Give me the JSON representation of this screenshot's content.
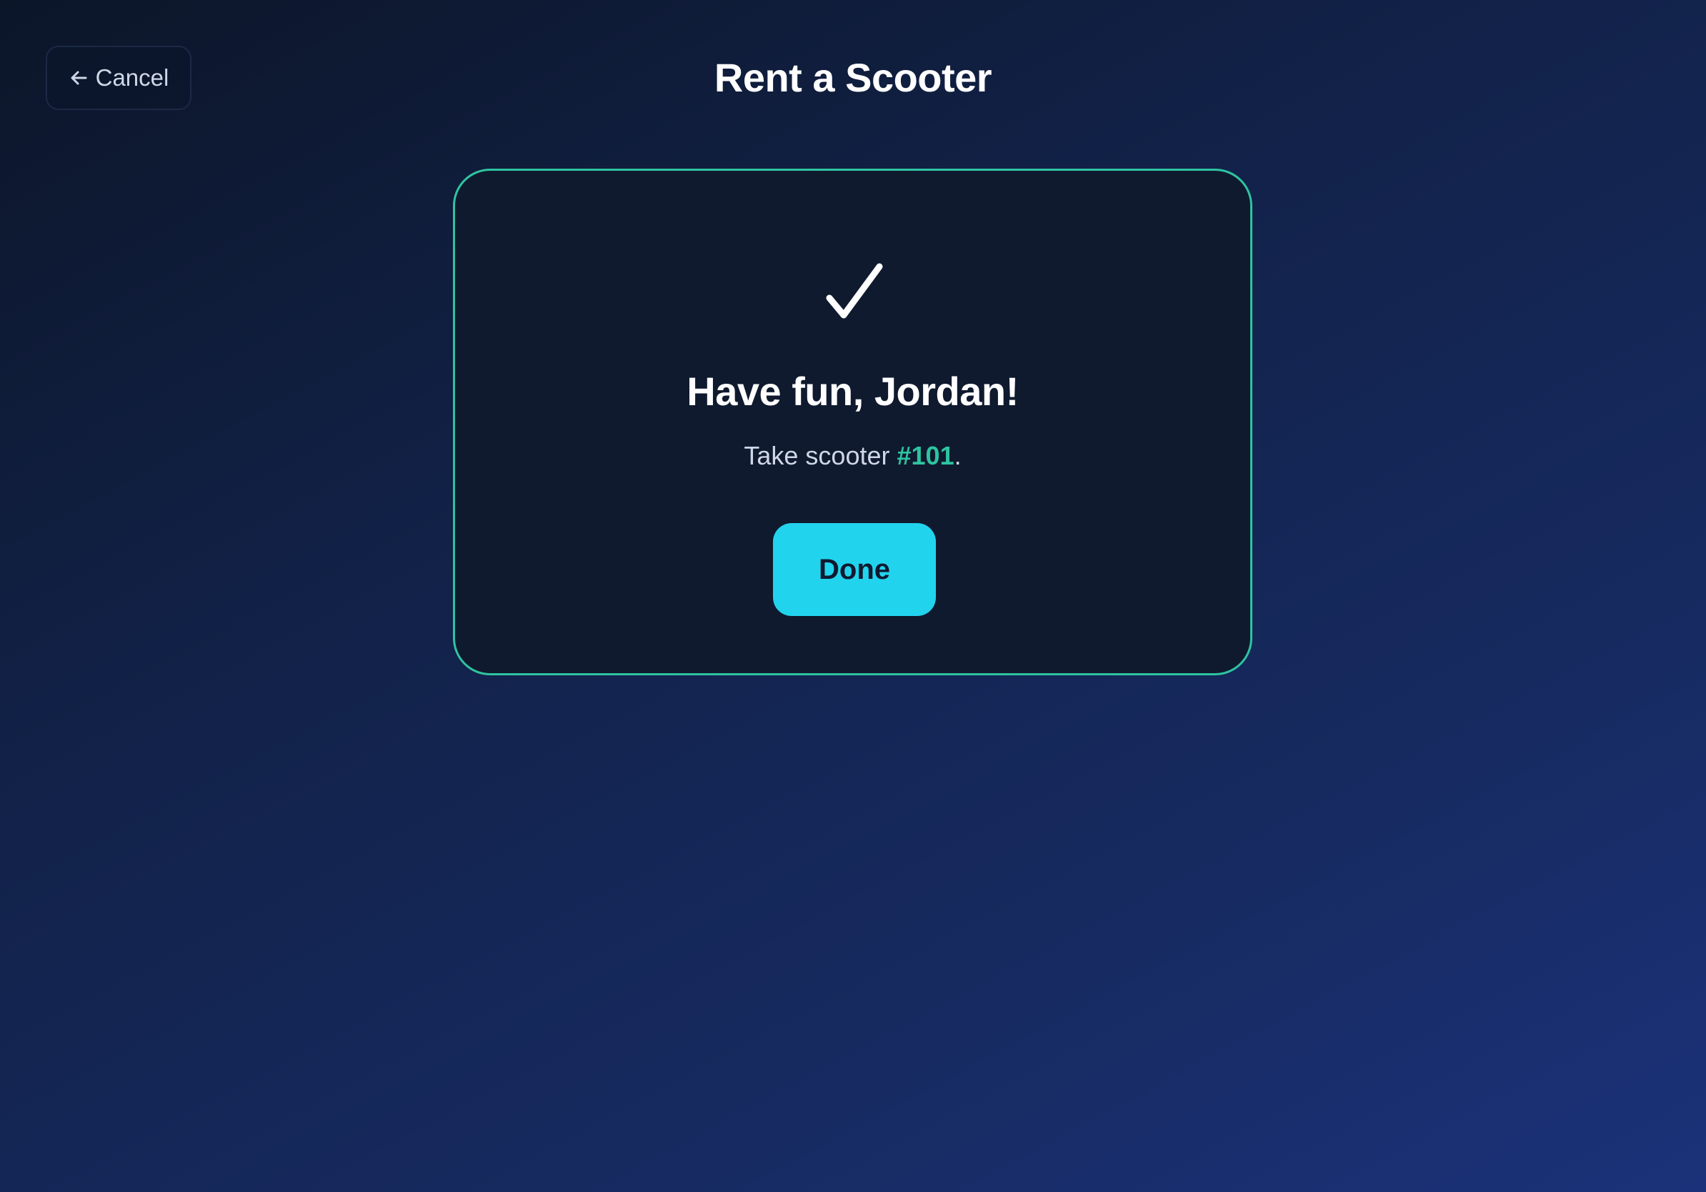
{
  "header": {
    "cancel_label": "Cancel",
    "cancel_icon": "arrow-left-icon",
    "title": "Rent a Scooter"
  },
  "card": {
    "icon": "check-icon",
    "heading": "Have fun, Jordan!",
    "message_prefix": "Take scooter ",
    "scooter_number": "#101",
    "message_suffix": ".",
    "done_label": "Done"
  },
  "colors": {
    "accent_green": "#2ec4a0",
    "accent_cyan": "#22d3ee",
    "card_background": "#0f1a2f"
  }
}
